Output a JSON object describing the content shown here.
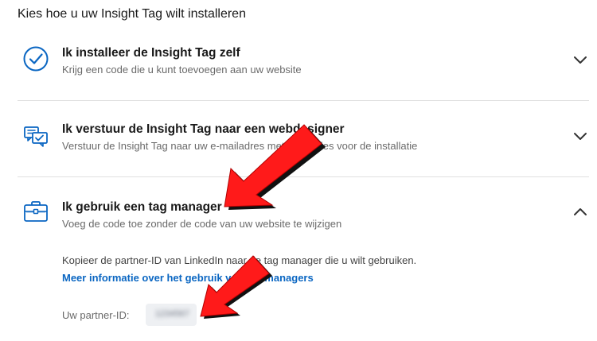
{
  "page": {
    "title": "Kies hoe u uw Insight Tag wilt installeren"
  },
  "options": [
    {
      "title": "Ik installeer de Insight Tag zelf",
      "subtitle": "Krijg een code die u kunt toevoegen aan uw website",
      "icon": "check-circle-icon",
      "expanded": false
    },
    {
      "title": "Ik verstuur de Insight Tag naar een webdesigner",
      "subtitle": "Verstuur de Insight Tag naar uw e-mailadres met instructies voor de installatie",
      "icon": "send-to-screen-icon",
      "expanded": false
    },
    {
      "title": "Ik gebruik een tag manager",
      "subtitle": "Voeg de code toe zonder de code van uw website te wijzigen",
      "icon": "briefcase-icon",
      "expanded": true
    }
  ],
  "tag_manager": {
    "instructions": "Kopieer de partner-ID van LinkedIn naar de tag manager die u wilt gebruiken.",
    "learn_more_link": "Meer informatie over het gebruik van tag managers",
    "partner_id_label": "Uw partner-ID:",
    "partner_id_value": "1234567"
  },
  "colors": {
    "accent": "#0a66c2",
    "arrow": "#ff1a1a",
    "divider": "#e0e0e0"
  }
}
